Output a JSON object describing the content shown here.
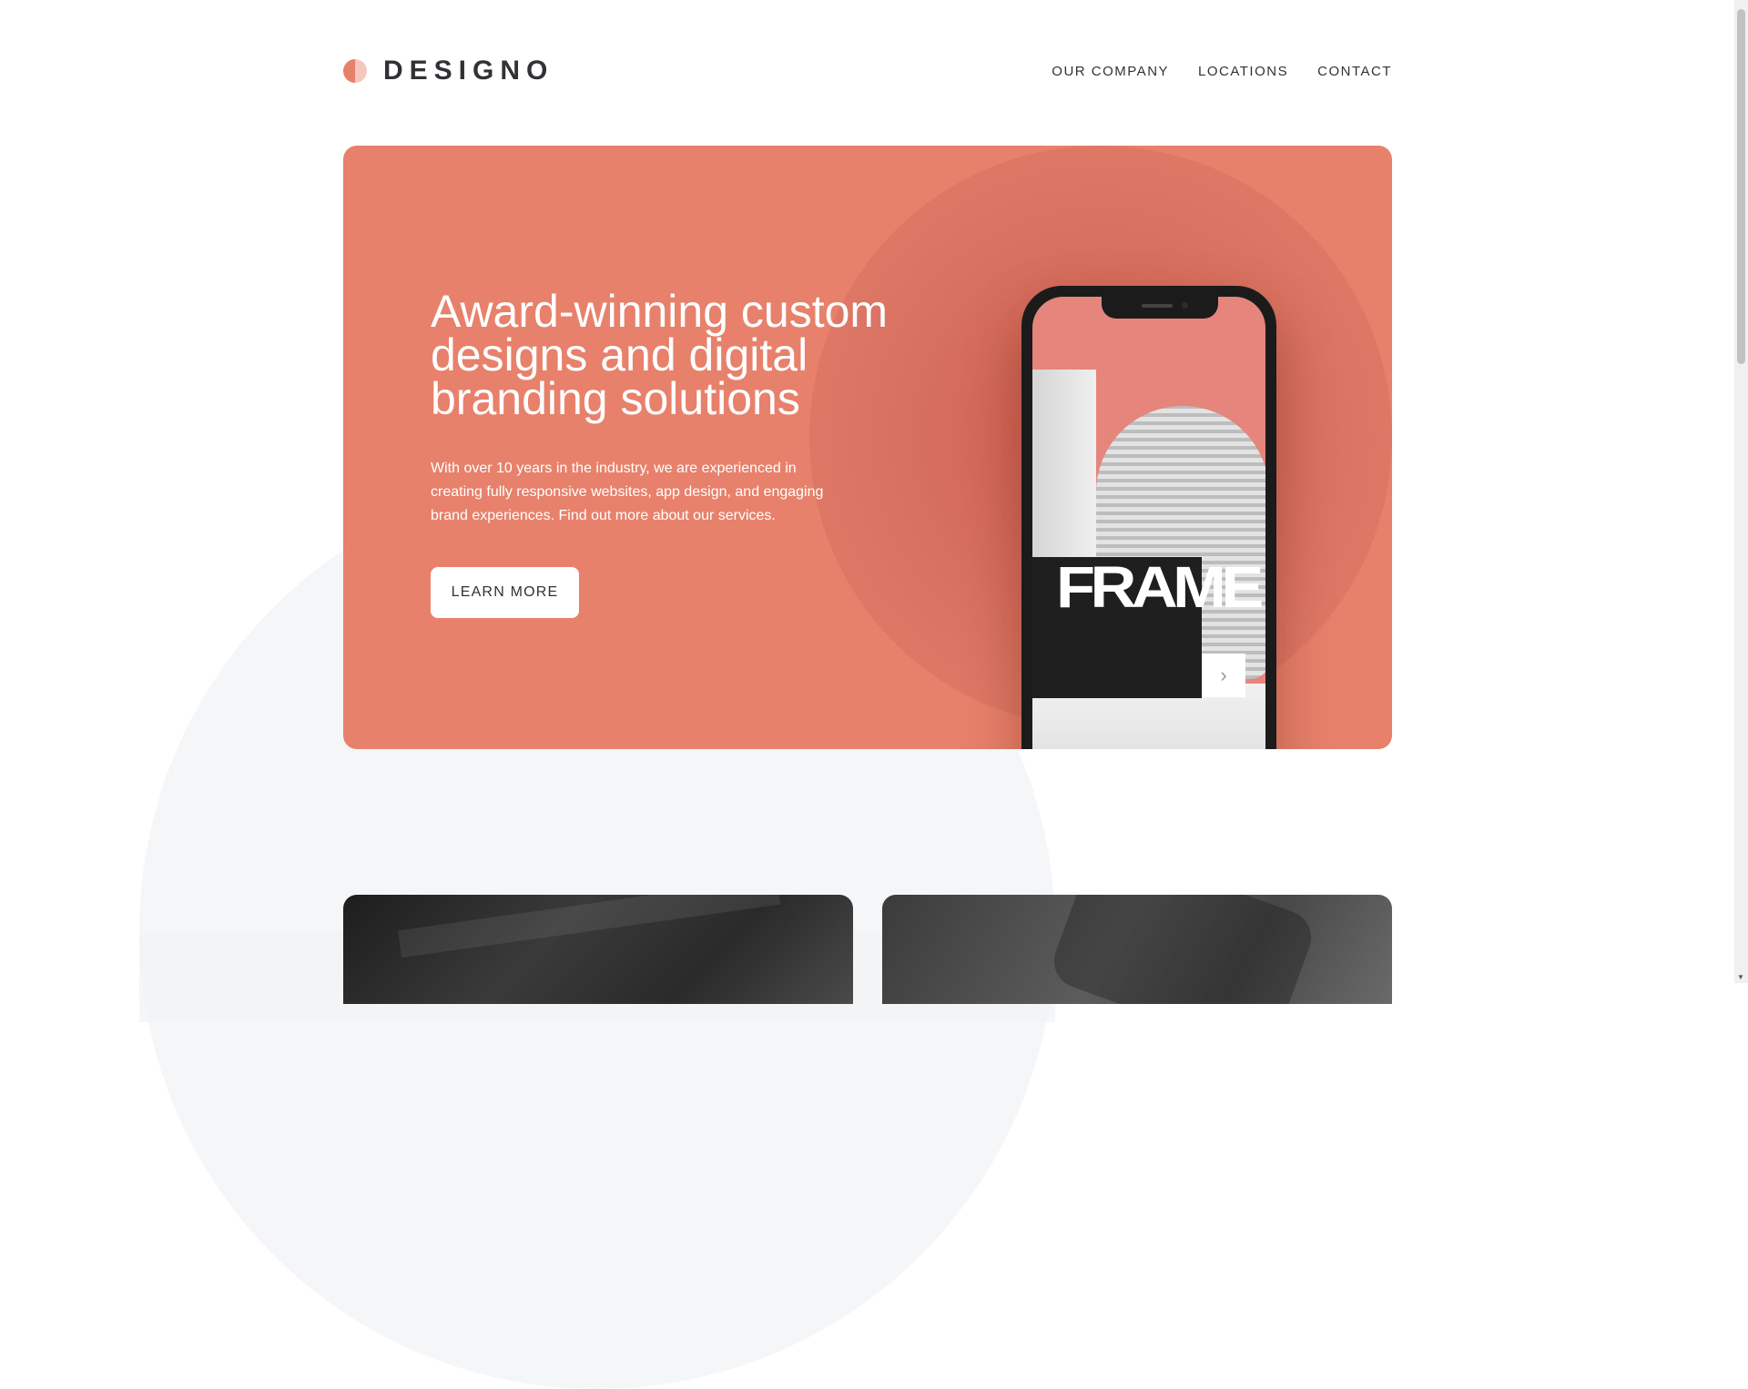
{
  "header": {
    "logo_text": "DESIGNO",
    "nav": [
      "OUR COMPANY",
      "LOCATIONS",
      "CONTACT"
    ]
  },
  "hero": {
    "title": "Award-winning custom designs and digital branding solutions",
    "description": "With over 10 years in the industry, we are experienced in creating fully responsive websites, app design, and engaging brand experiences. Find out more about our services.",
    "cta_label": "LEARN MORE",
    "phone_screen_text": "FRAME",
    "phone_next_icon": "chevron-right-icon"
  },
  "colors": {
    "accent": "#e7816b",
    "dark": "#333136",
    "light_bg": "#f1f3f5"
  }
}
